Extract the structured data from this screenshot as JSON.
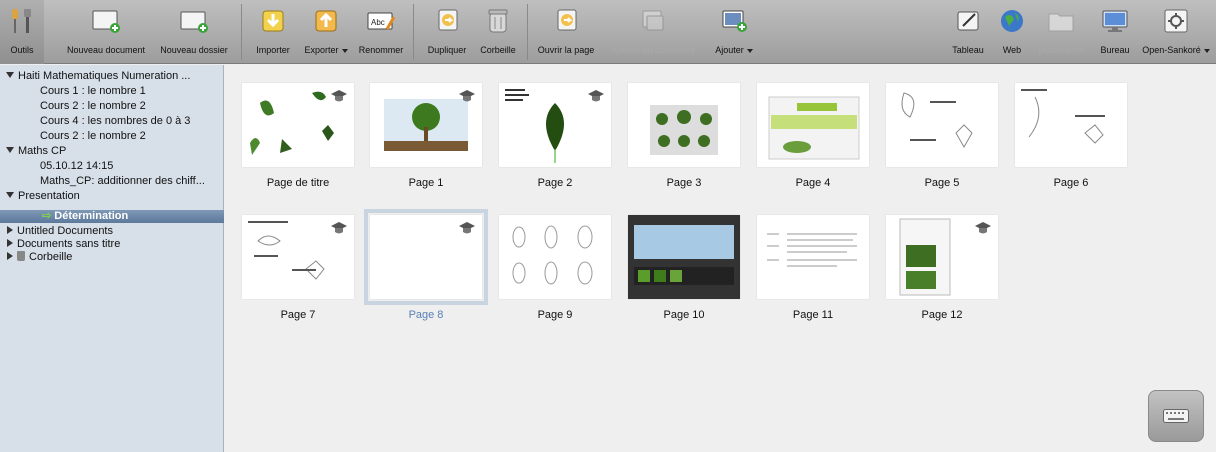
{
  "toolbar": {
    "outils": "Outils",
    "new_document": "Nouveau document",
    "new_folder": "Nouveau dossier",
    "import": "Importer",
    "export": "Exporter",
    "rename": "Renommer",
    "duplicate": "Dupliquer",
    "trash": "Corbeille",
    "open_page": "Ouvrir la page",
    "add_to_document": "Ajouter au document",
    "add": "Ajouter",
    "board": "Tableau",
    "web": "Web",
    "documents": "Documents",
    "desktop": "Bureau",
    "open_sankore": "Open-Sankoré",
    "rename_icon_text": "Abc"
  },
  "sidebar": {
    "tree": [
      {
        "label": "Haiti Mathematiques Numeration ...",
        "level": 0,
        "expanded": true
      },
      {
        "label": "Cours 1 : le nombre 1",
        "level": 1
      },
      {
        "label": "Cours 2 : le nombre 2",
        "level": 1
      },
      {
        "label": "Cours 4 : les nombres de 0 à 3",
        "level": 1
      },
      {
        "label": "Cours 2 : le nombre 2",
        "level": 1
      },
      {
        "label": "Maths CP",
        "level": 0,
        "expanded": true
      },
      {
        "label": "05.10.12 14:15",
        "level": 1
      },
      {
        "label": "Maths_CP: additionner des chiff...",
        "level": 1
      },
      {
        "label": "Presentation",
        "level": 0,
        "expanded": true
      },
      {
        "label": "Détermination",
        "level": 1,
        "selected": true
      },
      {
        "label": "Untitled Documents",
        "level": 0,
        "expanded": false
      },
      {
        "label": "Documents sans titre",
        "level": 0,
        "expanded": false
      },
      {
        "label": "Corbeille",
        "level": 0,
        "expanded": false,
        "trash": true
      }
    ]
  },
  "pages": [
    {
      "label": "Page de titre",
      "hat": true
    },
    {
      "label": "Page 1",
      "hat": true
    },
    {
      "label": "Page 2",
      "hat": true
    },
    {
      "label": "Page 3",
      "hat": false
    },
    {
      "label": "Page 4",
      "hat": false
    },
    {
      "label": "Page 5",
      "hat": false
    },
    {
      "label": "Page 6",
      "hat": false
    },
    {
      "label": "Page 7",
      "hat": true
    },
    {
      "label": "Page 8",
      "hat": true,
      "selected": true
    },
    {
      "label": "Page 9",
      "hat": false
    },
    {
      "label": "Page 10",
      "hat": false
    },
    {
      "label": "Page 11",
      "hat": false
    },
    {
      "label": "Page 12",
      "hat": true
    }
  ],
  "colors": {
    "sidebar_bg": "#d7dfe9",
    "selection": "#5d7a9c",
    "selected_caption": "#5a7fb5"
  }
}
